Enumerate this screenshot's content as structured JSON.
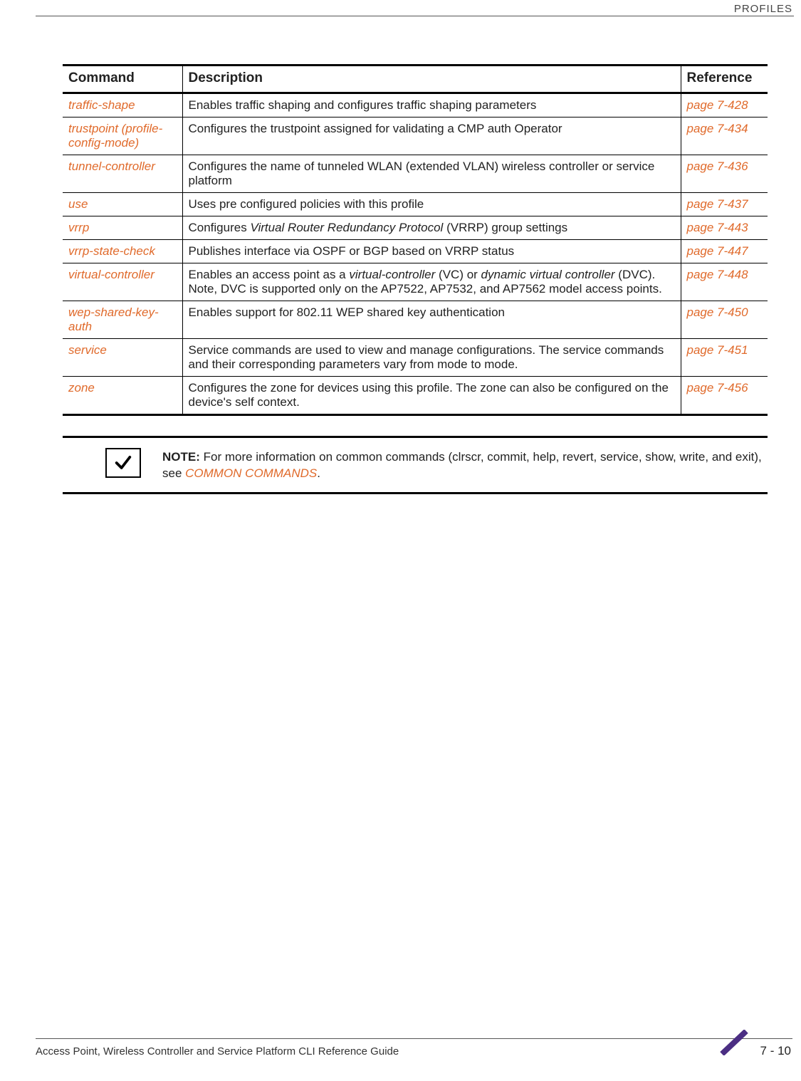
{
  "chapter_header": "PROFILES",
  "table": {
    "headers": {
      "command": "Command",
      "description": "Description",
      "reference": "Reference"
    },
    "rows": [
      {
        "command": "traffic-shape",
        "description": "Enables traffic shaping and configures traffic shaping parameters",
        "reference": "page 7-428"
      },
      {
        "command": "trustpoint (profile-config-mode)",
        "description": "Configures the trustpoint assigned for validating a CMP auth Operator",
        "reference": "page 7-434"
      },
      {
        "command": "tunnel-controller",
        "description": "Configures the name of tunneled WLAN (extended VLAN) wireless controller or service platform",
        "reference": "page 7-436"
      },
      {
        "command": "use",
        "description": "Uses pre configured policies with this profile",
        "reference": "page 7-437"
      },
      {
        "command": "vrrp",
        "description_pre": "Configures ",
        "description_italic": "Virtual Router Redundancy Protocol",
        "description_post": " (VRRP) group settings",
        "reference": "page 7-443"
      },
      {
        "command": "vrrp-state-check",
        "description": "Publishes interface via OSPF or BGP based on VRRP status",
        "reference": "page 7-447"
      },
      {
        "command": "virtual-controller",
        "description_pre": "Enables an access point as a ",
        "description_italic": "virtual-controller",
        "description_mid": " (VC) or ",
        "description_italic2": "dynamic virtual controller",
        "description_post": " (DVC). Note, DVC is supported only on the AP7522, AP7532, and AP7562 model access points.",
        "reference": "page 7-448"
      },
      {
        "command": "wep-shared-key-auth",
        "description": "Enables support for 802.11 WEP shared key authentication",
        "reference": "page 7-450"
      },
      {
        "command": "service",
        "description": "Service commands are used to view and manage configurations. The service commands and their corresponding parameters vary from mode to mode.",
        "reference": "page 7-451"
      },
      {
        "command": "zone",
        "description": "Configures the zone for devices using this profile. The zone can also be configured on the device's self context.",
        "reference": "page 7-456"
      }
    ]
  },
  "note": {
    "label": "NOTE:",
    "text_pre": " For more information on common commands (clrscr, commit, help, revert, service, show, write, and exit), see ",
    "link": "COMMON COMMANDS",
    "text_post": "."
  },
  "footer": {
    "title": "Access Point, Wireless Controller and Service Platform CLI Reference Guide",
    "page": "7 - 10"
  }
}
